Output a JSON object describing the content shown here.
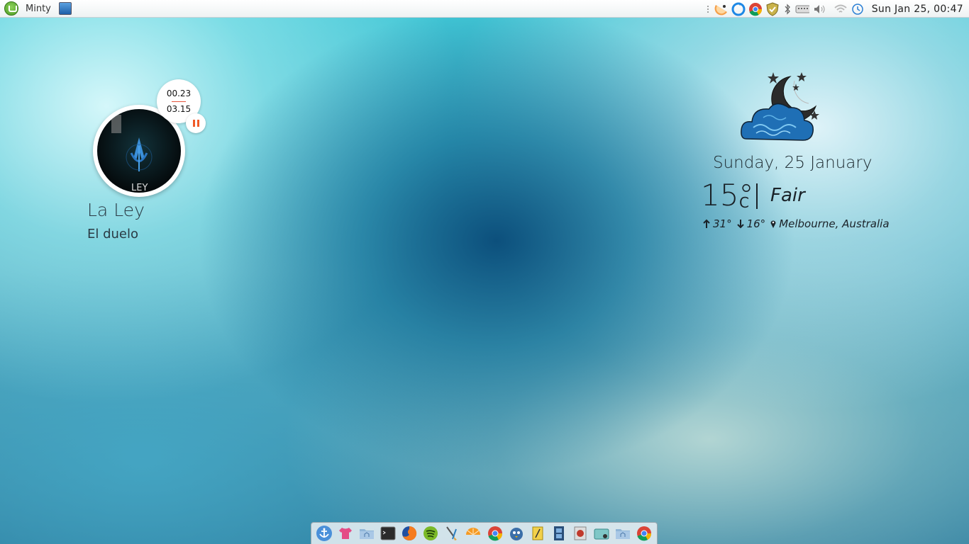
{
  "top_panel": {
    "menu_label": "Minty",
    "clock": "Sun Jan 25, 00:47",
    "tray_icons": [
      "overflow-dots-icon",
      "melon-icon",
      "sync-icon",
      "chrome-icon",
      "shield-icon",
      "bluetooth-icon",
      "keyboard-icon",
      "volume-icon",
      "wifi-icon",
      "clock-icon"
    ]
  },
  "music": {
    "elapsed": "00.23",
    "total": "03.15",
    "artist": "La Ley",
    "song": "El duelo",
    "album_text": "LEY",
    "accent": "#f05a28"
  },
  "weather": {
    "date": "Sunday, 25 January",
    "temp": "15°",
    "unit": "C",
    "condition": "Fair",
    "high": "31°",
    "low": "16°",
    "location": "Melbourne, Australia",
    "icon": "night-cloud-moon-stars-icon"
  },
  "dock": {
    "items": [
      "anchor-icon",
      "tshirt-icon",
      "home-folder-icon",
      "terminal-icon",
      "firefox-icon",
      "spotify-icon",
      "brush-icon",
      "orange-icon",
      "chrome-icon",
      "pidgin-icon",
      "notes-icon",
      "film-icon",
      "image-viewer-icon",
      "screenshot-icon",
      "home-folder-icon",
      "chrome-icon"
    ]
  }
}
